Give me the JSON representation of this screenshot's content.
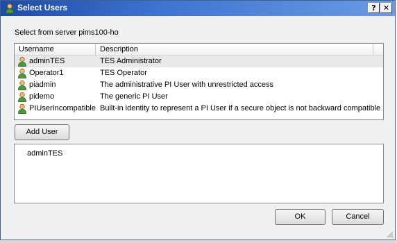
{
  "window": {
    "title": "Select Users",
    "help_label": "?",
    "close_label": "✕",
    "colors": {
      "titlebar": "#1e4aa8",
      "selection": "#e8e8e8"
    }
  },
  "server_label": "Select from server pims100-ho",
  "list": {
    "columns": [
      "Username",
      "Description"
    ],
    "rows": [
      {
        "user": "adminTES",
        "desc": "TES Administrator",
        "selected": true,
        "icon": "user-icon"
      },
      {
        "user": "Operator1",
        "desc": "TES Operator",
        "selected": false,
        "icon": "user-icon"
      },
      {
        "user": "piadmin",
        "desc": "The administrative PI User with unrestricted access",
        "selected": false,
        "icon": "user-icon"
      },
      {
        "user": "pidemo",
        "desc": "The generic PI User",
        "selected": false,
        "icon": "user-icon"
      },
      {
        "user": "PIUserIncompatible",
        "desc": "Built-in identity to represent a PI User if a secure object is not backward compatible",
        "selected": false,
        "icon": "user-icon"
      }
    ]
  },
  "add_button": "Add User",
  "selected_users": [
    "adminTES"
  ],
  "buttons": {
    "ok": "OK",
    "cancel": "Cancel"
  }
}
